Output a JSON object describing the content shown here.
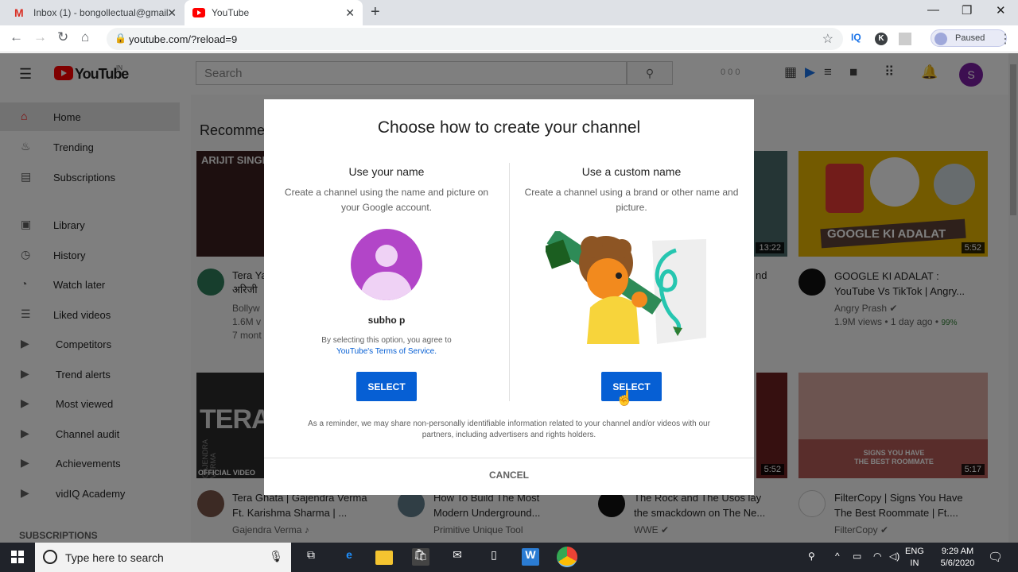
{
  "browser": {
    "tabs": [
      {
        "label": "Inbox (1) - bongollectual@gmail",
        "favicon": "gmail-icon"
      },
      {
        "label": "YouTube",
        "favicon": "youtube-icon",
        "active": true
      }
    ],
    "url": "youtube.com/?reload=9",
    "profile_status": "Paused",
    "extensions": [
      "IQ",
      "K"
    ]
  },
  "youtube": {
    "logo": "YouTube",
    "logo_country": "IN",
    "search_placeholder": "Search",
    "avatar_letter": "S",
    "section_title": "Recomme",
    "sidebar": [
      {
        "label": "Home",
        "icon": "home-icon",
        "active": true
      },
      {
        "label": "Trending",
        "icon": "flame-icon"
      },
      {
        "label": "Subscriptions",
        "icon": "subscriptions-icon"
      },
      {
        "label": "Library",
        "icon": "library-icon"
      },
      {
        "label": "History",
        "icon": "history-icon"
      },
      {
        "label": "Watch later",
        "icon": "clock-icon"
      },
      {
        "label": "Liked videos",
        "icon": "playlist-icon"
      },
      {
        "label": "Competitors",
        "icon": "playlist-icon"
      },
      {
        "label": "Trend alerts",
        "icon": "playlist-icon"
      },
      {
        "label": "Most viewed",
        "icon": "playlist-icon"
      },
      {
        "label": "Channel audit",
        "icon": "playlist-icon"
      },
      {
        "label": "Achievements",
        "icon": "playlist-icon"
      },
      {
        "label": "vidIQ Academy",
        "icon": "playlist-icon"
      }
    ],
    "sidebar_subs_header": "SUBSCRIPTIONS",
    "videos": [
      {
        "thumb_text": "ARIJIT SINGH",
        "title": "Tera Ya\nअरिजी",
        "channel": "Bollyw",
        "stats": "1.6M v",
        "extra": "7 mont",
        "duration": ""
      },
      {
        "thumb_text": "",
        "title": "nd",
        "channel": "",
        "stats": "",
        "extra": "",
        "duration": "13:22"
      },
      {
        "thumb_text": "GOOGLE KI ADALAT",
        "title": "GOOGLE KI ADALAT :\nYouTube Vs TikTok | Angry...",
        "channel": "Angry Prash ✔",
        "stats": "1.9M views • 1 day ago •",
        "extra": "99%",
        "duration": "5:52"
      },
      {
        "thumb_text": "TERA GH",
        "title": "Tera Ghata | Gajendra Verma\nFt. Karishma Sharma | ...",
        "channel": "Gajendra Verma ♪",
        "stats": "",
        "extra": "",
        "duration": "",
        "label_top": "GAJENDRA VERMA",
        "label_bottom": "OFFICIAL VIDEO"
      },
      {
        "thumb_text": "",
        "title": "How To Build The Most\nModern Underground...",
        "channel": "Primitive Unique Tool",
        "stats": "",
        "extra": "",
        "duration": ""
      },
      {
        "thumb_text": "",
        "title": "The Rock and The Usos lay\nthe smackdown on The Ne...",
        "channel": "WWE ✔",
        "stats": "",
        "extra": "",
        "duration": "5:52"
      },
      {
        "thumb_text": "SIGNS YOU HAVE\nTHE BEST ROOMMATE",
        "title": "FilterCopy | Signs You Have\nThe Best Roommate | Ft....",
        "channel": "FilterCopy ✔",
        "stats": "",
        "extra": "",
        "duration": "5:17"
      }
    ]
  },
  "dialog": {
    "title": "Choose how to create your channel",
    "left": {
      "heading": "Use your name",
      "description": "Create a channel using the name and picture on your Google account.",
      "user_name": "subho p",
      "terms_prefix": "By selecting this option, you agree to",
      "terms_link": "YouTube's Terms of Service.",
      "button": "SELECT"
    },
    "right": {
      "heading": "Use a custom name",
      "description": "Create a channel using a brand or other name and picture.",
      "button": "SELECT"
    },
    "reminder": "As a reminder, we may share non-personally identifiable information related to your channel and/or videos with our partners, including advertisers and rights holders.",
    "cancel": "CANCEL"
  },
  "taskbar": {
    "search_placeholder": "Type here to search",
    "lang_line1": "ENG",
    "lang_line2": "IN",
    "time": "9:29 AM",
    "date": "5/6/2020"
  },
  "colors": {
    "youtube_red": "#ff0000",
    "select_blue": "#065fd4",
    "avatar_purple": "#b245c8",
    "taskbar": "#20232a"
  }
}
